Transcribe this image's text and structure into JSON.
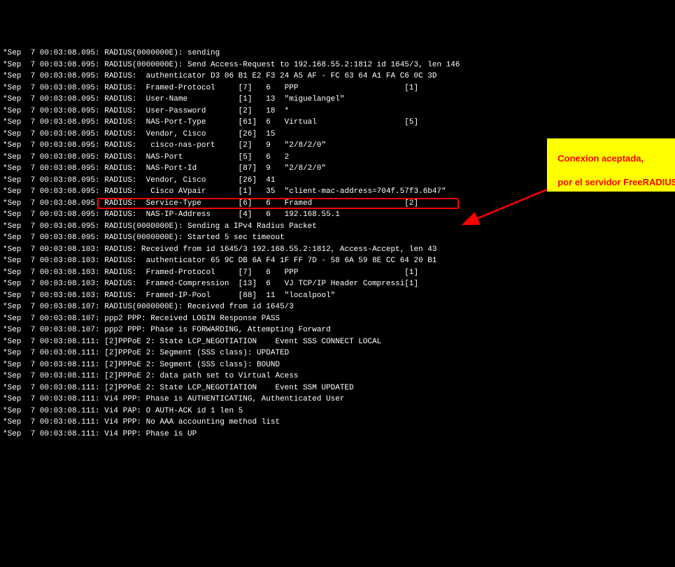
{
  "annotation": {
    "line1": "Conexion aceptada,",
    "line2": "por el servidor FreeRADIUS"
  },
  "highlighted_line_index": 14,
  "log": [
    "*Sep  7 00:03:08.095: RADIUS(0000000E): sending",
    "*Sep  7 00:03:08.095: RADIUS(0000000E): Send Access-Request to 192.168.55.2:1812 id 1645/3, len 146",
    "*Sep  7 00:03:08.095: RADIUS:  authenticator D3 06 B1 E2 F3 24 A5 AF - FC 63 64 A1 FA C6 0C 3D",
    "*Sep  7 00:03:08.095: RADIUS:  Framed-Protocol     [7]   6   PPP                       [1]",
    "*Sep  7 00:03:08.095: RADIUS:  User-Name           [1]   13  \"miguelangel\"",
    "*Sep  7 00:03:08.095: RADIUS:  User-Password       [2]   18  *",
    "*Sep  7 00:03:08.095: RADIUS:  NAS-Port-Type       [61]  6   Virtual                   [5]",
    "*Sep  7 00:03:08.095: RADIUS:  Vendor, Cisco       [26]  15",
    "*Sep  7 00:03:08.095: RADIUS:   cisco-nas-port     [2]   9   \"2/8/2/0\"",
    "*Sep  7 00:03:08.095: RADIUS:  NAS-Port            [5]   6   2",
    "*Sep  7 00:03:08.095: RADIUS:  NAS-Port-Id         [87]  9   \"2/8/2/0\"",
    "*Sep  7 00:03:08.095: RADIUS:  Vendor, Cisco       [26]  41",
    "*Sep  7 00:03:08.095: RADIUS:   Cisco AVpair       [1]   35  \"client-mac-address=704f.57f3.6b47\"",
    "*Sep  7 00:03:08.095: RADIUS:  Service-Type        [6]   6   Framed                    [2]",
    "*Sep  7 00:03:08.095: RADIUS:  NAS-IP-Address      [4]   6   192.168.55.1",
    "*Sep  7 00:03:08.095: RADIUS(0000000E): Sending a IPv4 Radius Packet",
    "*Sep  7 00:03:08.095: RADIUS(0000000E): Started 5 sec timeout",
    "*Sep  7 00:03:08.103: RADIUS: Received from id 1645/3 192.168.55.2:1812, Access-Accept, len 43",
    "*Sep  7 00:03:08.103: RADIUS:  authenticator 65 9C DB 6A F4 1F FF 7D - 58 6A 59 8E CC 64 20 B1",
    "*Sep  7 00:03:08.103: RADIUS:  Framed-Protocol     [7]   6   PPP                       [1]",
    "*Sep  7 00:03:08.103: RADIUS:  Framed-Compression  [13]  6   VJ TCP/IP Header Compressi[1]",
    "*Sep  7 00:03:08.103: RADIUS:  Framed-IP-Pool      [88]  11  \"localpool\"",
    "*Sep  7 00:03:08.107: RADIUS(0000000E): Received from id 1645/3",
    "*Sep  7 00:03:08.107: ppp2 PPP: Received LOGIN Response PASS",
    "*Sep  7 00:03:08.107: ppp2 PPP: Phase is FORWARDING, Attempting Forward",
    "*Sep  7 00:03:08.111: [2]PPPoE 2: State LCP_NEGOTIATION    Event SSS CONNECT LOCAL",
    "*Sep  7 00:03:08.111: [2]PPPoE 2: Segment (SSS class): UPDATED",
    "*Sep  7 00:03:08.111: [2]PPPoE 2: Segment (SSS class): BOUND",
    "*Sep  7 00:03:08.111: [2]PPPoE 2: data path set to Virtual Acess",
    "*Sep  7 00:03:08.111: [2]PPPoE 2: State LCP_NEGOTIATION    Event SSM UPDATED",
    "*Sep  7 00:03:08.111: Vi4 PPP: Phase is AUTHENTICATING, Authenticated User",
    "*Sep  7 00:03:08.111: Vi4 PAP: O AUTH-ACK id 1 len 5",
    "*Sep  7 00:03:08.111: Vi4 PPP: No AAA accounting method list",
    "*Sep  7 00:03:08.111: Vi4 PPP: Phase is UP"
  ]
}
